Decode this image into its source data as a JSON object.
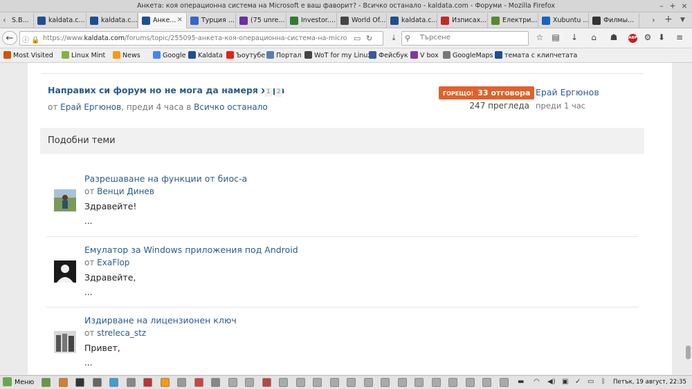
{
  "window": {
    "title": "Анкета: коя операционна система на Microsoft е ваш фаворит? - Всичко останало - kaldata.com - Форуми - Mozilla Firefox"
  },
  "tabs": [
    {
      "label": "S.B...",
      "favicon": "tab-favicon",
      "color": "#888888"
    },
    {
      "label": "kaldata.c...",
      "favicon": "kaldata-icon",
      "color": "#1d4f91"
    },
    {
      "label": "kaldata.c...",
      "favicon": "kaldata-icon",
      "color": "#1d4f91"
    },
    {
      "label": "Анке...",
      "favicon": "kaldata-icon",
      "color": "#1d4f91",
      "active": true
    },
    {
      "label": "Турция ...",
      "favicon": "wikipedia-icon",
      "color": "#3366cc"
    },
    {
      "label": "(75 unre...",
      "favicon": "mail-icon",
      "color": "#6b2fa0"
    },
    {
      "label": "Investor....",
      "favicon": "investor-icon",
      "color": "#2e7d32"
    },
    {
      "label": "World Of...",
      "favicon": "wot-icon",
      "color": "#444444"
    },
    {
      "label": "kaldata.c...",
      "favicon": "kaldata-icon",
      "color": "#1d4f91"
    },
    {
      "label": "Изписах...",
      "favicon": "red-icon",
      "color": "#c62828"
    },
    {
      "label": "Електри...",
      "favicon": "green-icon",
      "color": "#558b2f"
    },
    {
      "label": "Xubuntu ...",
      "favicon": "xubuntu-icon",
      "color": "#1565c0"
    },
    {
      "label": "Филмы...",
      "favicon": "film-icon",
      "color": "#333333"
    }
  ],
  "nav": {
    "url_prefix": "https://www.",
    "url_domain": "kaldata.com",
    "url_rest": "/forums/topic/255095-анкета-коя-операционна-система-на-microsoft-е-ваш-ф",
    "search_placeholder": "Търсене",
    "abp_label": "ABP"
  },
  "bookmarks": [
    {
      "label": "Most Visited",
      "icon": "most-visited-icon",
      "color": "#d35400"
    },
    {
      "label": "Linux Mint",
      "icon": "linux-mint-icon",
      "color": "#87b13f"
    },
    {
      "label": "News",
      "icon": "rss-icon",
      "color": "#f39c12"
    },
    {
      "label": "Google",
      "icon": "google-icon",
      "color": "#4285f4"
    },
    {
      "label": "Kaldata",
      "icon": "kaldata-icon",
      "color": "#1d4f91"
    },
    {
      "label": "Ъоутубе",
      "icon": "youtube-icon",
      "color": "#e62117"
    },
    {
      "label": "Портал",
      "icon": "portal-icon",
      "color": "#5d7ea8"
    },
    {
      "label": "WoT for my Linux",
      "icon": "wot-icon",
      "color": "#444444"
    },
    {
      "label": "Фейсбук",
      "icon": "facebook-icon",
      "color": "#3b5998"
    },
    {
      "label": "V box",
      "icon": "vbox-icon",
      "color": "#7d3c98"
    },
    {
      "label": "GoogleMaps",
      "icon": "maps-icon",
      "color": "#777777"
    },
    {
      "label": "темата с клипчетата",
      "icon": "kaldata-icon",
      "color": "#1d4f91"
    }
  ],
  "topic": {
    "title": "Направих си форум но не мога да намеря хора",
    "pages": [
      "1",
      "2"
    ],
    "by_prefix": "от",
    "author": "Ерай Ергюнов",
    "time_text": ", преди 4 часа в",
    "forum": "Всичко останало",
    "hot_label": "ГОРЕЩО!",
    "replies": "33 отговора",
    "views": "247 прегледа",
    "last_user": "Ерай Ергюнов",
    "last_time": "преди 1 час"
  },
  "similar": {
    "heading": "Подобни теми",
    "items": [
      {
        "title": "Разрешаване на функции от биос-а",
        "by": "от",
        "author": "Венци Динев",
        "preview": "Здравейте!",
        "ellipsis": "..."
      },
      {
        "title": "Емулатор за Windows приложения под Android",
        "by": "от",
        "author": "ExaFlop",
        "preview": "Здравейте,",
        "ellipsis": "..."
      },
      {
        "title": "Издирване на лицензионен ключ",
        "by": "от",
        "author": "streleca_stz",
        "preview": "Привет,",
        "ellipsis": "..."
      }
    ]
  },
  "taskbar": {
    "menu_label": "Меню",
    "clock": "Петък, 19 август, 22:35"
  }
}
